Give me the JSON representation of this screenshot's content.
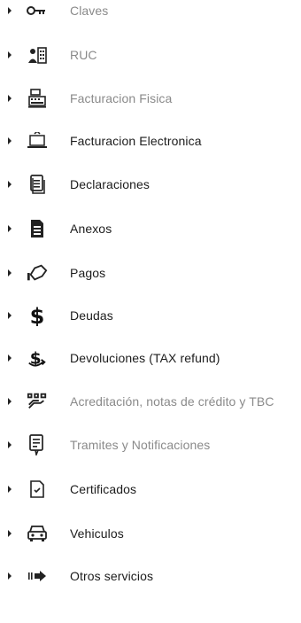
{
  "menu": {
    "items": [
      {
        "label": "Claves",
        "icon": "key-icon"
      },
      {
        "label": "RUC",
        "icon": "building-person-icon"
      },
      {
        "label": "Facturacion Fisica",
        "icon": "cash-register-icon"
      },
      {
        "label": "Facturacion Electronica",
        "icon": "laptop-document-icon"
      },
      {
        "label": "Declaraciones",
        "icon": "document-lines-icon"
      },
      {
        "label": "Anexos",
        "icon": "document-filled-icon"
      },
      {
        "label": "Pagos",
        "icon": "hand-tag-icon"
      },
      {
        "label": "Deudas",
        "icon": "dollar-icon"
      },
      {
        "label": "Devoluciones (TAX refund)",
        "icon": "dollar-refund-icon"
      },
      {
        "label": "Acreditación, notas de crédito y TBC",
        "icon": "cards-hand-icon"
      },
      {
        "label": "Tramites y Notificaciones",
        "icon": "notification-document-icon"
      },
      {
        "label": "Certificados",
        "icon": "certificate-document-icon"
      },
      {
        "label": "Vehiculos",
        "icon": "car-icon"
      },
      {
        "label": "Otros servicios",
        "icon": "arrow-right-bars-icon"
      }
    ]
  }
}
